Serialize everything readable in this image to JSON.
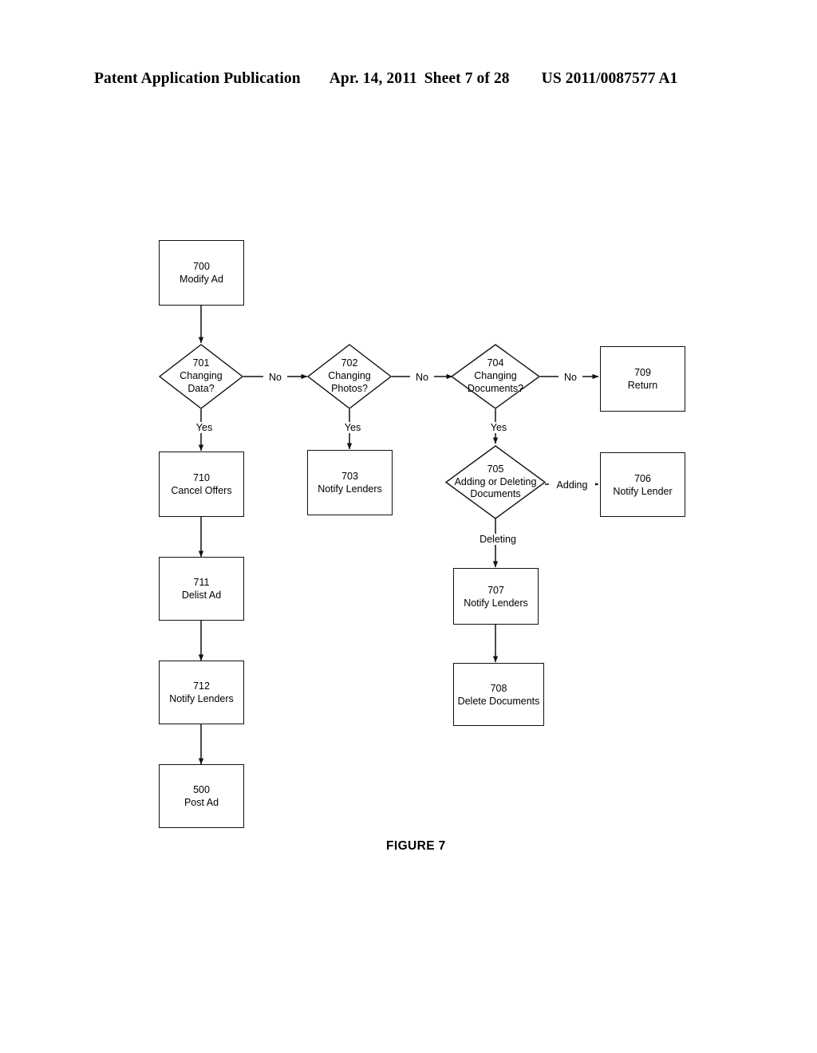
{
  "header": {
    "publication": "Patent Application Publication",
    "date": "Apr. 14, 2011",
    "sheet": "Sheet 7 of 28",
    "pub_number": "US 2011/0087577 A1"
  },
  "figure": {
    "caption": "FIGURE 7"
  },
  "chart_data": {
    "type": "diagram",
    "title": "FIGURE 7",
    "nodes": [
      {
        "id": "700",
        "shape": "process",
        "num": "700",
        "label": "Modify Ad"
      },
      {
        "id": "701",
        "shape": "decision",
        "num": "701",
        "label": "Changing Data?"
      },
      {
        "id": "702",
        "shape": "decision",
        "num": "702",
        "label": "Changing Photos?"
      },
      {
        "id": "704",
        "shape": "decision",
        "num": "704",
        "label": "Changing Documents?"
      },
      {
        "id": "709",
        "shape": "process",
        "num": "709",
        "label": "Return"
      },
      {
        "id": "710",
        "shape": "process",
        "num": "710",
        "label": "Cancel Offers"
      },
      {
        "id": "703",
        "shape": "process",
        "num": "703",
        "label": "Notify Lenders"
      },
      {
        "id": "705",
        "shape": "decision",
        "num": "705",
        "label": "Adding or Deleting Documents"
      },
      {
        "id": "706",
        "shape": "process",
        "num": "706",
        "label": "Notify Lender"
      },
      {
        "id": "707",
        "shape": "process",
        "num": "707",
        "label": "Notify Lenders"
      },
      {
        "id": "711",
        "shape": "process",
        "num": "711",
        "label": "Delist Ad"
      },
      {
        "id": "708",
        "shape": "process",
        "num": "708",
        "label": "Delete Documents"
      },
      {
        "id": "712",
        "shape": "process",
        "num": "712",
        "label": "Notify Lenders"
      },
      {
        "id": "500",
        "shape": "process",
        "num": "500",
        "label": "Post Ad"
      }
    ],
    "edges": [
      {
        "from": "700",
        "to": "701",
        "label": ""
      },
      {
        "from": "701",
        "to": "702",
        "label": "No"
      },
      {
        "from": "701",
        "to": "710",
        "label": "Yes"
      },
      {
        "from": "702",
        "to": "704",
        "label": "No"
      },
      {
        "from": "702",
        "to": "703",
        "label": "Yes"
      },
      {
        "from": "704",
        "to": "709",
        "label": "No"
      },
      {
        "from": "704",
        "to": "705",
        "label": "Yes"
      },
      {
        "from": "705",
        "to": "706",
        "label": "Adding"
      },
      {
        "from": "705",
        "to": "707",
        "label": "Deleting"
      },
      {
        "from": "707",
        "to": "708",
        "label": ""
      },
      {
        "from": "710",
        "to": "711",
        "label": ""
      },
      {
        "from": "711",
        "to": "712",
        "label": ""
      },
      {
        "from": "712",
        "to": "500",
        "label": ""
      }
    ]
  },
  "nodes": {
    "n700": {
      "num": "700",
      "label": "Modify Ad"
    },
    "n701": {
      "num": "701",
      "line1": "Changing",
      "line2": "Data?"
    },
    "n702": {
      "num": "702",
      "line1": "Changing",
      "line2": "Photos?"
    },
    "n704": {
      "num": "704",
      "line1": "Changing",
      "line2": "Documents?"
    },
    "n709": {
      "num": "709",
      "label": "Return"
    },
    "n710": {
      "num": "710",
      "label": "Cancel Offers"
    },
    "n703": {
      "num": "703",
      "label": "Notify Lenders"
    },
    "n705": {
      "num": "705",
      "line1": "Adding or Deleting",
      "line2": "Documents"
    },
    "n706": {
      "num": "706",
      "label": "Notify Lender"
    },
    "n707": {
      "num": "707",
      "label": "Notify Lenders"
    },
    "n711": {
      "num": "711",
      "label": "Delist Ad"
    },
    "n708": {
      "num": "708",
      "label": "Delete Documents"
    },
    "n712": {
      "num": "712",
      "label": "Notify Lenders"
    },
    "n500": {
      "num": "500",
      "label": "Post Ad"
    }
  },
  "edge_labels": {
    "no_701_702": "No",
    "no_702_704": "No",
    "no_704_709": "No",
    "yes_701": "Yes",
    "yes_702": "Yes",
    "yes_704": "Yes",
    "adding_705_706": "Adding",
    "deleting_705_707": "Deleting"
  },
  "colors": {
    "ink": "#111111",
    "paper": "#ffffff"
  }
}
